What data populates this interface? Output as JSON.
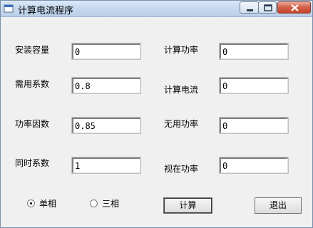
{
  "window": {
    "title": "计算电流程序",
    "controls": {
      "minimize": "minimize-icon",
      "maximize": "maximize-icon",
      "close": "close-icon"
    }
  },
  "left_fields": [
    {
      "label": "安装容量",
      "value": "0"
    },
    {
      "label": "需用系数",
      "value": "0.8"
    },
    {
      "label": "功率因数",
      "value": "0.85"
    },
    {
      "label": "同时系数",
      "value": "1"
    }
  ],
  "right_fields": [
    {
      "label": "计算功率",
      "value": "0"
    },
    {
      "label": "计算电流",
      "value": "0"
    },
    {
      "label": "无用功率",
      "value": "0"
    },
    {
      "label": "视在功率",
      "value": "0"
    }
  ],
  "phase": {
    "options": [
      "单相",
      "三相"
    ],
    "selected": "单相"
  },
  "buttons": {
    "calculate": "计算",
    "exit": "退出"
  }
}
